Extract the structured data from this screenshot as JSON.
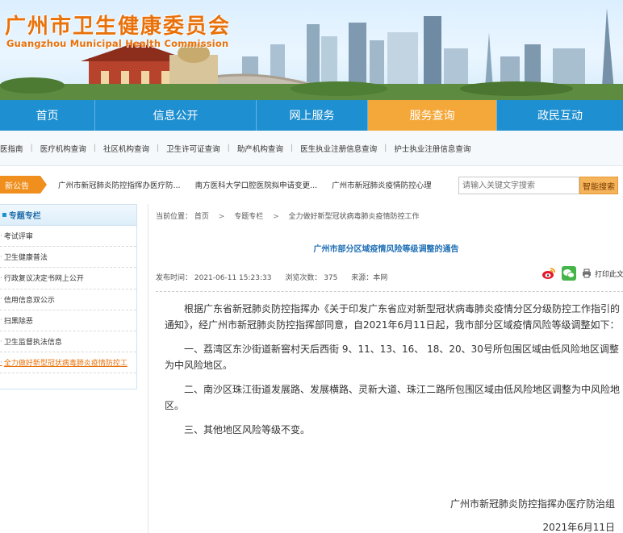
{
  "header": {
    "title": "广州市卫生健康委员会",
    "subtitle": "Guangzhou Municipal Health Commission"
  },
  "nav": [
    {
      "label": "首页",
      "active": false
    },
    {
      "label": "信息公开",
      "active": false
    },
    {
      "label": "网上服务",
      "active": false
    },
    {
      "label": "服务查询",
      "active": true
    },
    {
      "label": "政民互动",
      "active": false
    }
  ],
  "subnav": [
    "医指南",
    "医疗机构查询",
    "社区机构查询",
    "卫生许可证查询",
    "助产机构查询",
    "医生执业注册信息查询",
    "护士执业注册信息查询"
  ],
  "notice": {
    "tag": "新公告",
    "items": [
      "广州市新冠肺炎防控指挥办医疗防...",
      "南方医科大学口腔医院拟申请变更...",
      "广州市新冠肺炎疫情防控心理"
    ]
  },
  "search": {
    "placeholder": "请输入关键文字搜索",
    "button": "智能搜索"
  },
  "sidebar": {
    "title": "专题专栏",
    "items": [
      {
        "label": "考试评审",
        "active": false
      },
      {
        "label": "卫生健康普法",
        "active": false
      },
      {
        "label": "行政复议决定书网上公开",
        "active": false
      },
      {
        "label": "信用信息双公示",
        "active": false
      },
      {
        "label": "扫黑除恶",
        "active": false
      },
      {
        "label": "卫生监督执法信息",
        "active": false
      },
      {
        "label": "全力做好新型冠状病毒肺炎疫情防控工",
        "active": true
      }
    ]
  },
  "breadcrumb": {
    "prefix": "当前位置：",
    "items": [
      "首页",
      "专题专栏",
      "全力做好新型冠状病毒肺炎疫情防控工作"
    ]
  },
  "article": {
    "title": "广州市部分区域疫情风险等级调整的通告",
    "publish_time": "发布时间：  2021-06-11 15:23:33",
    "views": "浏览次数：   375",
    "source": "来源：本网",
    "print": "打印此文",
    "paragraphs": [
      "根据广东省新冠肺炎防控指挥办《关于印发广东省应对新型冠状病毒肺炎疫情分区分级防控工作指引的通知》，经广州市新冠肺炎防控指挥部同意，自2021年6月11日起，我市部分区域疫情风险等级调整如下：",
      "一、荔湾区东沙街道新窖村天后西街 9、11、13、16、 18、20、30号所包围区域由低风险地区调整为中风险地区。",
      "二、南沙区珠江街道发展路、发展横路、灵新大道、珠江二路所包围区域由低风险地区调整为中风险地区。",
      "三、其他地区风险等级不变。"
    ],
    "signature": "广州市新冠肺炎防控指挥办医疗防治组",
    "date": "2021年6月11日"
  },
  "colors": {
    "nav": "#1e8fd0",
    "nav_active": "#f5a83a",
    "accent": "#e8710a",
    "title_blue": "#1f6fb5"
  }
}
